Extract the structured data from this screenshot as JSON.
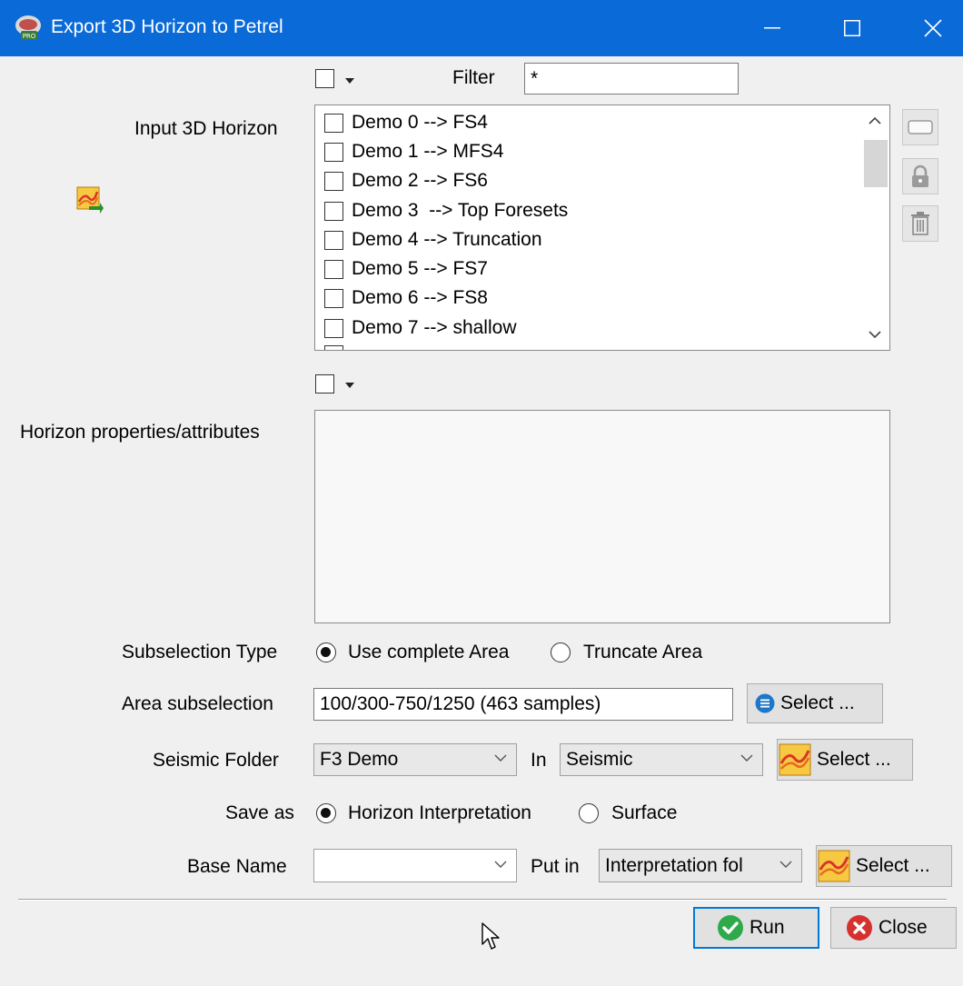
{
  "window": {
    "title": "Export 3D Horizon to Petrel",
    "title_bar_color": "#0a6ad8",
    "icons": [
      "app-icon",
      "minimize-icon",
      "maximize-icon",
      "close-icon"
    ]
  },
  "filter": {
    "label": "Filter",
    "value": "*"
  },
  "input_horizon": {
    "label": "Input 3D Horizon",
    "items": [
      "Demo 0 --> FS4",
      "Demo 1 --> MFS4",
      "Demo 2 --> FS6",
      "Demo 3  --> Top Foresets",
      "Demo 4 --> Truncation",
      "Demo 5 --> FS7",
      "Demo 6 --> FS8",
      "Demo 7 --> shallow"
    ]
  },
  "attributes": {
    "label": "Horizon properties/attributes"
  },
  "subselection_type": {
    "label": "Subselection Type",
    "options": [
      "Use complete Area",
      "Truncate Area"
    ],
    "selected": "Use complete Area"
  },
  "area_subselection": {
    "label": "Area subselection",
    "value": "100/300-750/1250 (463 samples)",
    "button": "Select ..."
  },
  "seismic_folder": {
    "label": "Seismic Folder",
    "value": "F3 Demo",
    "in_label": "In",
    "in_value": "Seismic",
    "button": "Select ..."
  },
  "save_as": {
    "label": "Save as",
    "options": [
      "Horizon Interpretation",
      "Surface"
    ],
    "selected": "Horizon Interpretation"
  },
  "base_name": {
    "label": "Base Name",
    "value": "",
    "put_in_label": "Put in",
    "put_in_value": "Interpretation fol",
    "button": "Select ..."
  },
  "footer": {
    "run": "Run",
    "close": "Close"
  },
  "colors": {
    "accent": "#0078d7",
    "run_icon": "#2eaa4a",
    "close_icon": "#d6312f",
    "info_icon": "#1e77c9"
  }
}
